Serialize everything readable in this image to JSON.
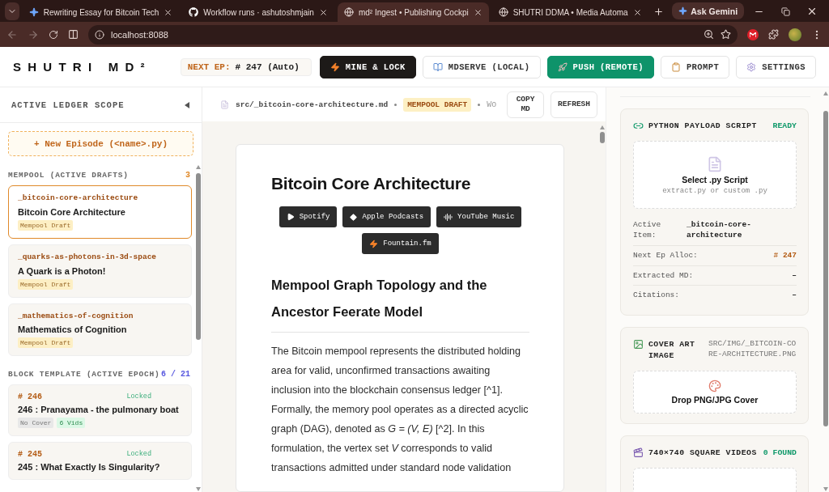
{
  "browser": {
    "tabs": [
      {
        "title": "Rewriting Essay for Bitcoin Tech",
        "selected": false
      },
      {
        "title": "Workflow runs · ashutoshmjain",
        "selected": false
      },
      {
        "title": "md² Ingest • Publishing Cockpi",
        "selected": true
      },
      {
        "title": "SHUTRI DDMA • Media Automa",
        "selected": false
      }
    ],
    "gemini": "Ask Gemini",
    "url": "localhost:8088"
  },
  "header": {
    "logo": "SHUTRI MD²",
    "next_ep": {
      "label": "NEXT EP:",
      "value": "# 247 (Auto)"
    },
    "buttons": [
      {
        "label": "MINE & LOCK",
        "kind": "dark"
      },
      {
        "label": "MDSERVE (LOCAL)",
        "kind": "light"
      },
      {
        "label": "PUSH (REMOTE)",
        "kind": "green"
      },
      {
        "label": "PROMPT",
        "kind": "light"
      },
      {
        "label": "SETTINGS",
        "kind": "light"
      }
    ]
  },
  "sidebar": {
    "title": "ACTIVE LEDGER SCOPE",
    "new_episode": "+ New Episode (<name>.py)",
    "mempool": {
      "title": "MEMPOOL (ACTIVE DRAFTS)",
      "count": "3",
      "items": [
        {
          "slug": "_bitcoin-core-architecture",
          "title": "Bitcoin Core Architecture",
          "tag": "Mempool Draft",
          "selected": true
        },
        {
          "slug": "_quarks-as-photons-in-3d-space",
          "title": "A Quark is a Photon!",
          "tag": "Mempool Draft",
          "selected": false
        },
        {
          "slug": "_mathematics-of-cognition",
          "title": "Mathematics of Cognition",
          "tag": "Mempool Draft",
          "selected": false
        }
      ]
    },
    "block_template": {
      "title": "BLOCK TEMPLATE (ACTIVE EPOCH)",
      "count": "6 / 21",
      "items": [
        {
          "number": "# 246",
          "status": "Locked",
          "title": "246 : Pranayama - the pulmonary boat",
          "tags": [
            {
              "label": "No Cover",
              "kind": "muted"
            },
            {
              "label": "6 Vids",
              "kind": "success"
            }
          ]
        },
        {
          "number": "# 245",
          "status": "Locked",
          "title": "245 : What Exactly Is Singularity?"
        }
      ]
    }
  },
  "doc_bar": {
    "path": "src/_bitcoin-core-architecture.md",
    "badge": "MEMPOOL DRAFT",
    "meta": "Wo",
    "buttons": [
      "COPY MD",
      "REFRESH"
    ]
  },
  "article": {
    "title": "Bitcoin Core Architecture",
    "platforms": [
      "Spotify",
      "Apple Podcasts",
      "YouTube Music",
      "Fountain.fm"
    ],
    "heading": "Mempool Graph Topology and the Ancestor Feerate Model",
    "paragraph": "The Bitcoin mempool represents the distributed holding area for valid, unconfirmed transactions awaiting inclusion into the blockchain consensus ledger [^1]. Formally, the memory pool operates as a directed acyclic graph (DAG), denoted as *G = (V, E)* [^2]. In this formulation, the vertex set *V* corresponds to valid transactions admitted under standard node validation"
  },
  "script_card": {
    "title": "PYTHON PAYLOAD SCRIPT",
    "status": "READY",
    "drop_title": "Select .py Script",
    "drop_hint": "extract.py or custom .py",
    "rows": [
      {
        "label": "Active Item:",
        "value": "_bitcoin-core-architecture",
        "kind": "block",
        "accent": false
      },
      {
        "label": "Next Ep Alloc:",
        "value": "# 247",
        "kind": "pair",
        "accent": true
      },
      {
        "label": "Extracted MD:",
        "value": "–",
        "kind": "pair",
        "accent": false
      },
      {
        "label": "Citations:",
        "value": "–",
        "kind": "pair",
        "accent": false
      }
    ]
  },
  "cover_card": {
    "title": "COVER ART IMAGE",
    "path": "SRC/IMG/_BITCOIN-CORE-ARCHITECTURE.PNG",
    "drop": "Drop PNG/JPG Cover"
  },
  "videos_card": {
    "title": "740×740 SQUARE VIDEOS",
    "status": "0 FOUND"
  }
}
